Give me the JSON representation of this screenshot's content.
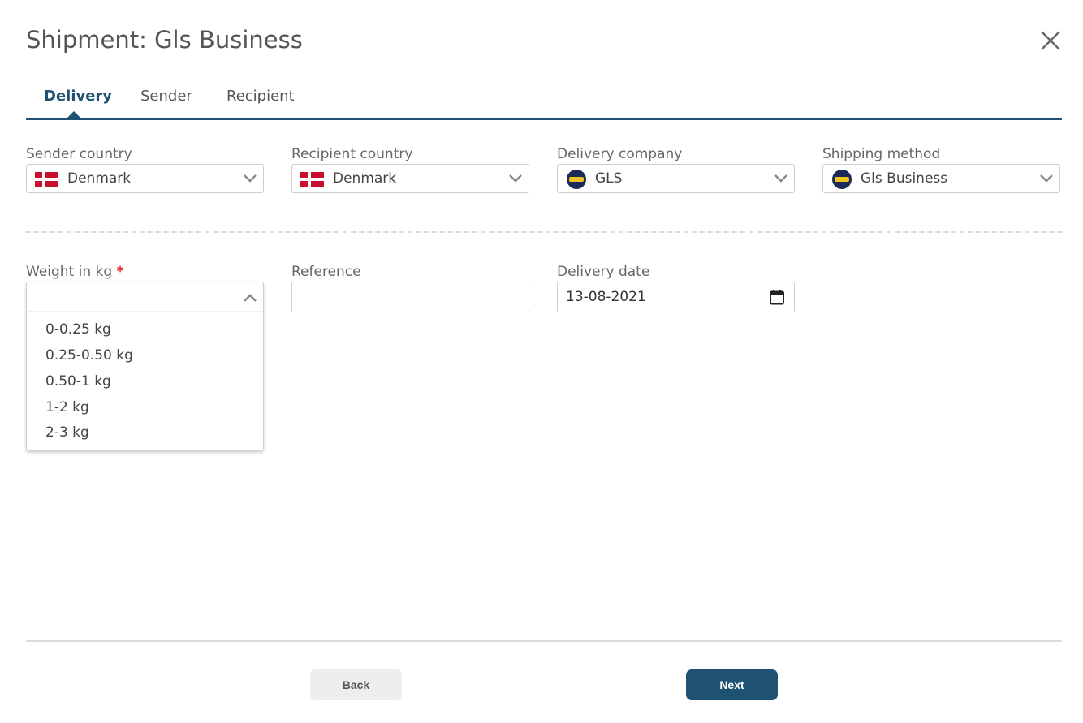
{
  "dialog": {
    "title": "Shipment: Gls Business"
  },
  "tabs": [
    {
      "label": "Delivery",
      "active": true
    },
    {
      "label": "Sender",
      "active": false
    },
    {
      "label": "Recipient",
      "active": false
    }
  ],
  "fields": {
    "sender_country": {
      "label": "Sender country",
      "value": "Denmark",
      "icon": "denmark-flag-icon"
    },
    "recipient_country": {
      "label": "Recipient country",
      "value": "Denmark",
      "icon": "denmark-flag-icon"
    },
    "delivery_company": {
      "label": "Delivery company",
      "value": "GLS",
      "icon": "gls-logo-icon"
    },
    "shipping_method": {
      "label": "Shipping method",
      "value": "Gls Business",
      "icon": "gls-logo-icon"
    },
    "weight": {
      "label": "Weight in kg",
      "required_mark": "*",
      "value": "",
      "options": [
        "0-0.25 kg",
        "0.25-0.50 kg",
        "0.50-1 kg",
        "1-2 kg",
        "2-3 kg"
      ]
    },
    "reference": {
      "label": "Reference",
      "value": ""
    },
    "delivery_date": {
      "label": "Delivery date",
      "value": "13-08-2021"
    }
  },
  "footer": {
    "back_label": "Back",
    "next_label": "Next"
  },
  "colors": {
    "accent": "#1f5272",
    "required": "#e0262a",
    "danish_red": "#c8102e"
  }
}
